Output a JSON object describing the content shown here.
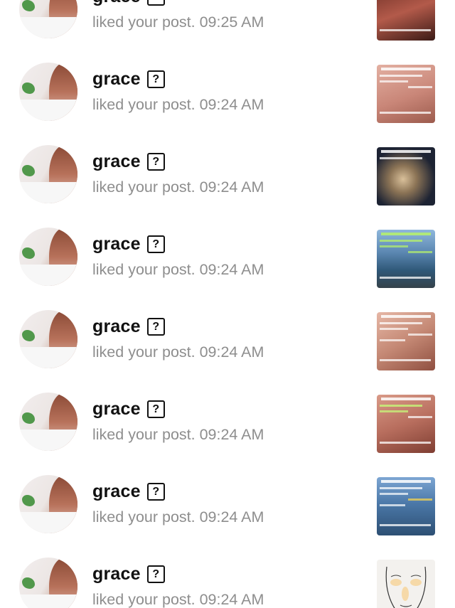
{
  "notifications": [
    {
      "username": "grace",
      "badge": "?",
      "activity": "liked your post. 09:25 AM",
      "thumb_color": "#b35a4a"
    },
    {
      "username": "grace",
      "badge": "?",
      "activity": "liked your post. 09:24 AM",
      "thumb_color": "#c98678"
    },
    {
      "username": "grace",
      "badge": "?",
      "activity": "liked your post. 09:24 AM",
      "thumb_color": "#1d2333"
    },
    {
      "username": "grace",
      "badge": "?",
      "activity": "liked your post. 09:24 AM",
      "thumb_color": "#3d6f98"
    },
    {
      "username": "grace",
      "badge": "?",
      "activity": "liked your post. 09:24 AM",
      "thumb_color": "#c48874"
    },
    {
      "username": "grace",
      "badge": "?",
      "activity": "liked your post. 09:24 AM",
      "thumb_color": "#b86e5e"
    },
    {
      "username": "grace",
      "badge": "?",
      "activity": "liked your post. 09:24 AM",
      "thumb_color": "#4b78a8"
    },
    {
      "username": "grace",
      "badge": "?",
      "activity": "liked your post. 09:24 AM",
      "thumb_color": "#f3f1ee"
    }
  ]
}
